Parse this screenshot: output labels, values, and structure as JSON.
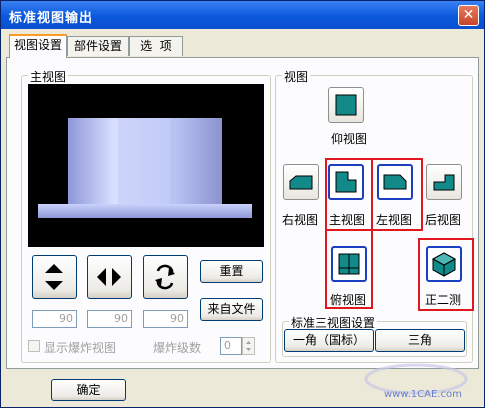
{
  "window": {
    "title": "标准视图输出",
    "close_glyph": "✕"
  },
  "tabs": [
    {
      "label": "视图设置",
      "active": true
    },
    {
      "label": "部件设置",
      "active": false
    },
    {
      "label": "选  项",
      "active": false
    }
  ],
  "main_view": {
    "label": "主视图",
    "spin_values": [
      "90",
      "90",
      "90"
    ],
    "reset_label": "重置",
    "from_file_label": "来自文件",
    "explode_checkbox_label": "显示爆炸视图",
    "explode_level_label": "爆炸级数",
    "explode_level_value": "0"
  },
  "views": {
    "label": "视图",
    "bottom_label": "仰视图",
    "right_label": "右视图",
    "main_label": "主视图",
    "left_label": "左视图",
    "back_label": "后视图",
    "top_label": "俯视图",
    "iso_label": "正二测"
  },
  "standard_three_view": {
    "label": "标准三视图设置",
    "first_angle_label": "一角（国标）",
    "third_angle_label": "三角"
  },
  "footer": {
    "ok_label": "确定"
  },
  "watermark": {
    "line1": "www.1CAE.com"
  },
  "colors": {
    "title_bar": "#0a58dc",
    "highlight": "#e0171e",
    "model": "#b4bfee"
  }
}
